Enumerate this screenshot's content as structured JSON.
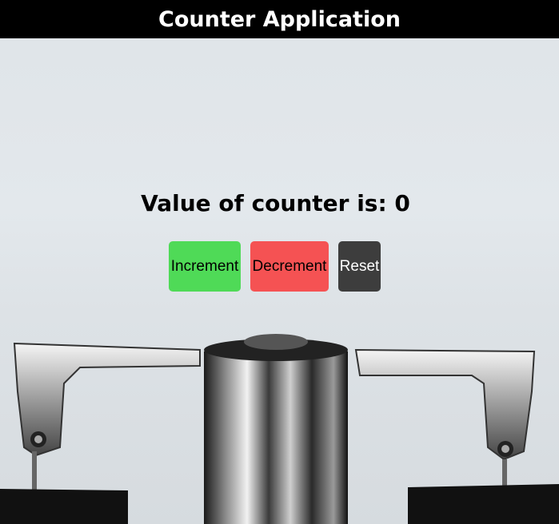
{
  "header": {
    "title": "Counter Application"
  },
  "counter": {
    "label": "Value of counter is: 0"
  },
  "buttons": {
    "increment": "Increment",
    "decrement": "Decrement",
    "reset": "Reset"
  },
  "colors": {
    "header_bg": "#000000",
    "increment_bg": "#4fda57",
    "decrement_bg": "#f55253",
    "reset_bg": "#3d3d3d"
  }
}
